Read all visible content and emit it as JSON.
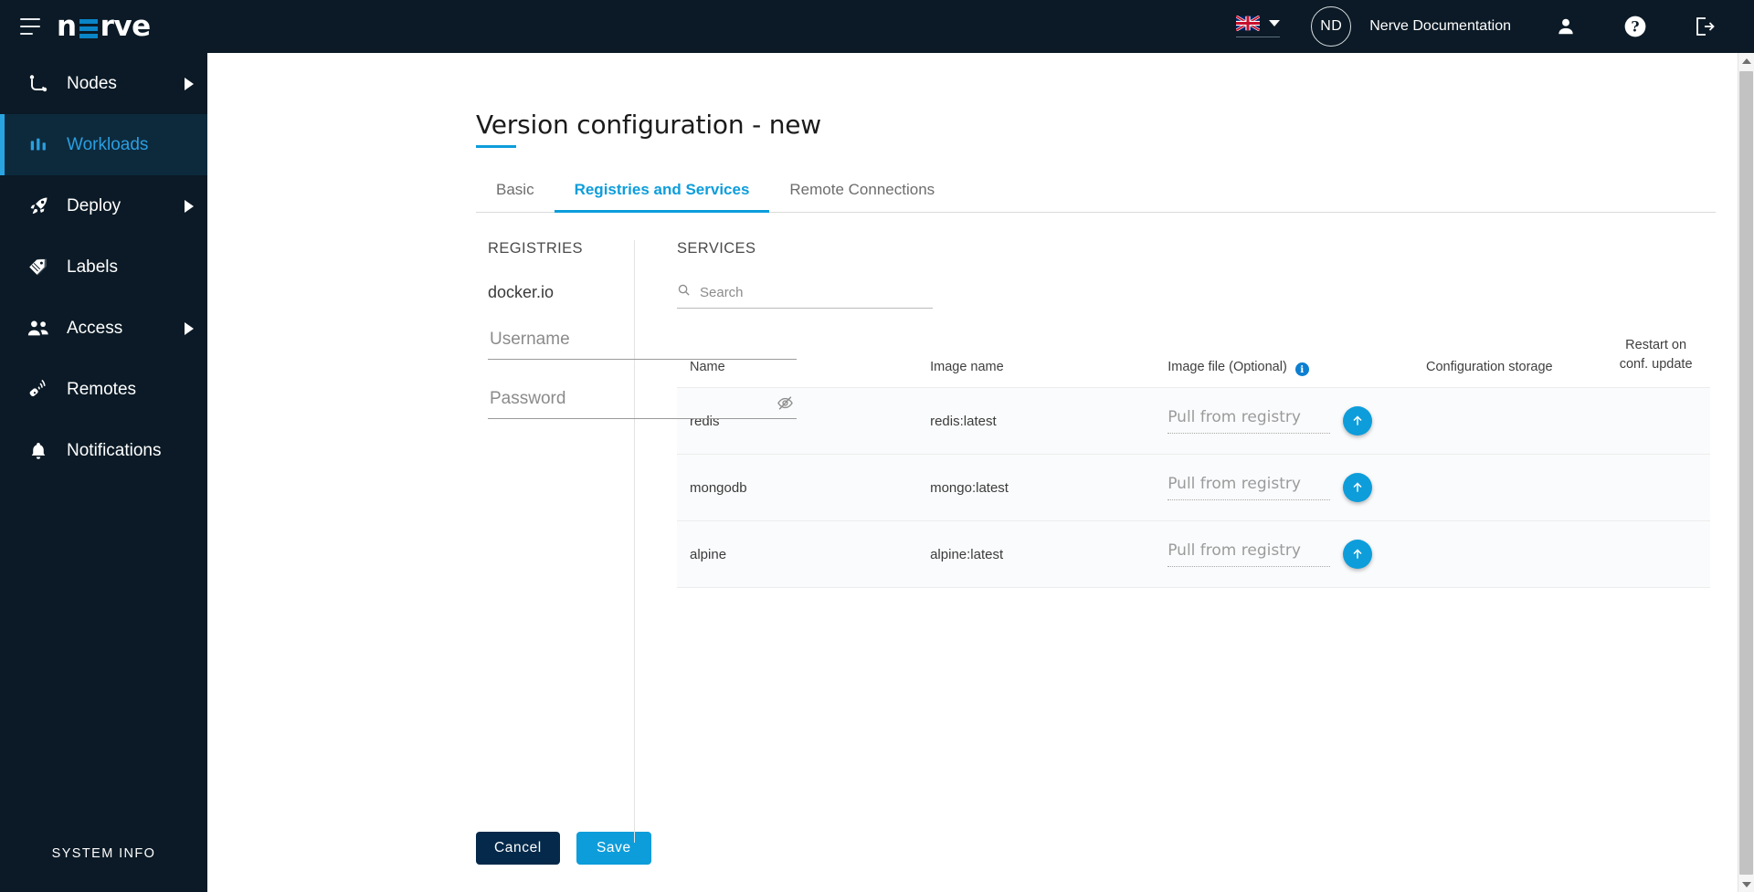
{
  "header": {
    "menu_icon": "hamburger-icon",
    "brand": {
      "part1": "n",
      "part2": "rve"
    },
    "language": {
      "flag": "uk-flag",
      "caret": "chevron-down-icon"
    },
    "avatar_initials": "ND",
    "user_name": "Nerve Documentation",
    "icons": [
      "person-icon",
      "help-icon",
      "logout-icon"
    ]
  },
  "sidebar": {
    "items": [
      {
        "label": "Nodes",
        "icon": "nodes-icon",
        "has_arrow": true,
        "active": false
      },
      {
        "label": "Workloads",
        "icon": "workloads-icon",
        "has_arrow": false,
        "active": true
      },
      {
        "label": "Deploy",
        "icon": "rocket-icon",
        "has_arrow": true,
        "active": false
      },
      {
        "label": "Labels",
        "icon": "tag-icon",
        "has_arrow": false,
        "active": false
      },
      {
        "label": "Access",
        "icon": "users-icon",
        "has_arrow": true,
        "active": false
      },
      {
        "label": "Remotes",
        "icon": "remote-icon",
        "has_arrow": false,
        "active": false
      },
      {
        "label": "Notifications",
        "icon": "bell-icon",
        "has_arrow": false,
        "active": false
      }
    ],
    "system_info": "SYSTEM INFO"
  },
  "page": {
    "title": "Version configuration - new",
    "tabs": [
      {
        "label": "Basic",
        "active": false
      },
      {
        "label": "Registries and Services",
        "active": true
      },
      {
        "label": "Remote Connections",
        "active": false
      }
    ]
  },
  "registries": {
    "section_label": "REGISTRIES",
    "registry_name": "docker.io",
    "username": {
      "value": "",
      "placeholder": "Username"
    },
    "password": {
      "value": "",
      "placeholder": "Password",
      "toggle_icon": "eye-off-icon"
    }
  },
  "services": {
    "section_label": "SERVICES",
    "search": {
      "value": "",
      "placeholder": "Search",
      "icon": "search-icon"
    },
    "columns": [
      {
        "key": "name",
        "label": "Name"
      },
      {
        "key": "image",
        "label": "Image name"
      },
      {
        "key": "file",
        "label": "Image file (Optional)",
        "info": "i"
      },
      {
        "key": "conf",
        "label": "Configuration storage"
      },
      {
        "key": "restart",
        "label_line1": "Restart on",
        "label_line2": "conf. update"
      }
    ],
    "rows": [
      {
        "name": "redis",
        "image": "redis:latest",
        "file_placeholder": "Pull from registry",
        "upload_icon": "upload-arrow-icon",
        "conf": "",
        "restart": ""
      },
      {
        "name": "mongodb",
        "image": "mongo:latest",
        "file_placeholder": "Pull from registry",
        "upload_icon": "upload-arrow-icon",
        "conf": "",
        "restart": ""
      },
      {
        "name": "alpine",
        "image": "alpine:latest",
        "file_placeholder": "Pull from registry",
        "upload_icon": "upload-arrow-icon",
        "conf": "",
        "restart": ""
      }
    ]
  },
  "footer": {
    "cancel_label": "Cancel",
    "save_label": "Save"
  },
  "colors": {
    "dark_navy": "#0b1a26",
    "accent_blue": "#0d9ddb",
    "active_nav_bg": "#0d2a3d",
    "cancel_navy": "#04294a"
  }
}
